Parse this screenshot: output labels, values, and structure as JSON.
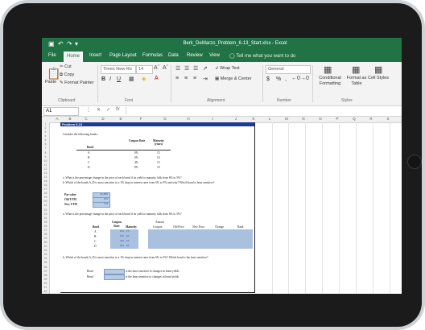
{
  "window": {
    "title": "Berk_DeMarzo_Problem_6-13_Start.xlsx - Excel"
  },
  "ribbon_tabs": [
    "File",
    "Home",
    "Insert",
    "Page Layout",
    "Formulas",
    "Data",
    "Review",
    "View"
  ],
  "tell_me": "Tell me what you want to do",
  "clipboard": {
    "cut": "Cut",
    "copy": "Copy",
    "paste": "Paste",
    "format_painter": "Format Painter",
    "group": "Clipboard"
  },
  "font": {
    "name": "Times New Ro",
    "size": "14",
    "group": "Font",
    "bold": "B",
    "italic": "I",
    "underline": "U"
  },
  "alignment": {
    "wrap": "Wrap Text",
    "merge": "Merge & Center",
    "group": "Alignment"
  },
  "number": {
    "format": "General",
    "currency": "$",
    "percent": "%",
    "comma": ",",
    "group": "Number"
  },
  "styles": {
    "conditional": "Conditional Formatting",
    "format_table": "Format as Table",
    "cell_styles": "Cell Styles",
    "group": "Styles"
  },
  "formula_bar": {
    "name_box": "A1",
    "fx": "fx"
  },
  "columns": [
    "A",
    "B",
    "C",
    "D",
    "E",
    "F",
    "G",
    "H",
    "I",
    "J",
    "K",
    "L",
    "M",
    "N",
    "O",
    "P",
    "Q",
    "R",
    "S"
  ],
  "rows": [
    "1",
    "2",
    "3",
    "4",
    "5",
    "6",
    "7",
    "8",
    "9",
    "10",
    "11",
    "12",
    "13",
    "14",
    "15",
    "16",
    "17",
    "18",
    "19",
    "20",
    "21",
    "22",
    "23",
    "24",
    "25",
    "26",
    "27",
    "28",
    "29",
    "30",
    "31",
    "32",
    "33",
    "34",
    "35",
    "36",
    "37",
    "38",
    "39",
    "40",
    "41",
    "42"
  ],
  "sheet": {
    "problem_title": "Problem 6-13",
    "intro": "Consider the following bonds:",
    "bonds_table": {
      "header_coupon": "Coupon Rate",
      "header_maturity": "Maturity (years)",
      "header_bond": "Bond",
      "rows": [
        {
          "bond": "A",
          "coupon": "0%",
          "maturity": "15"
        },
        {
          "bond": "B",
          "coupon": "0%",
          "maturity": "10"
        },
        {
          "bond": "C",
          "coupon": "4%",
          "maturity": "15"
        },
        {
          "bond": "D",
          "coupon": "8%",
          "maturity": "10"
        }
      ]
    },
    "question_a": "a. What is the percentage change in the price of each bond if its yield to maturity falls from 6% to 5%?",
    "question_b": "b. Which of the bonds A–D is most sensitive to a 1% drop in interest rates from 6% to 5% and why? Which bond is least sensitive?",
    "inputs": [
      {
        "label": "Par value",
        "value": "$1,000"
      },
      {
        "label": "Old YTM",
        "value": "6%"
      },
      {
        "label": "New YTM",
        "value": "5%"
      }
    ],
    "question_a_repeat": "a. What is the percentage change in the price of each bond if its yield to maturity falls from 6% to 5%?",
    "calc_table": {
      "annual_label": "Annual",
      "headers": [
        "Bond",
        "Coupon Rate",
        "Maturity",
        "Coupon",
        "Old Price",
        "New Price",
        "Change",
        "Rank"
      ],
      "rows": [
        {
          "bond": "A",
          "rate": "0%",
          "maturity": "15"
        },
        {
          "bond": "B",
          "rate": "0%",
          "maturity": "10"
        },
        {
          "bond": "C",
          "rate": "4%",
          "maturity": "15"
        },
        {
          "bond": "D",
          "rate": "8%",
          "maturity": "10"
        }
      ]
    },
    "question_b_repeat": "b. Which of the bonds A–D is most sensitive to a 1% drop in interest rates from 6% to 5%? Which bond is the least sensitive?",
    "answers": [
      {
        "label": "Bond",
        "text": "is the most sensitive to changes in bond yields"
      },
      {
        "label": "Bond",
        "text": "is the least sensitive to changes in bond yields"
      }
    ]
  }
}
